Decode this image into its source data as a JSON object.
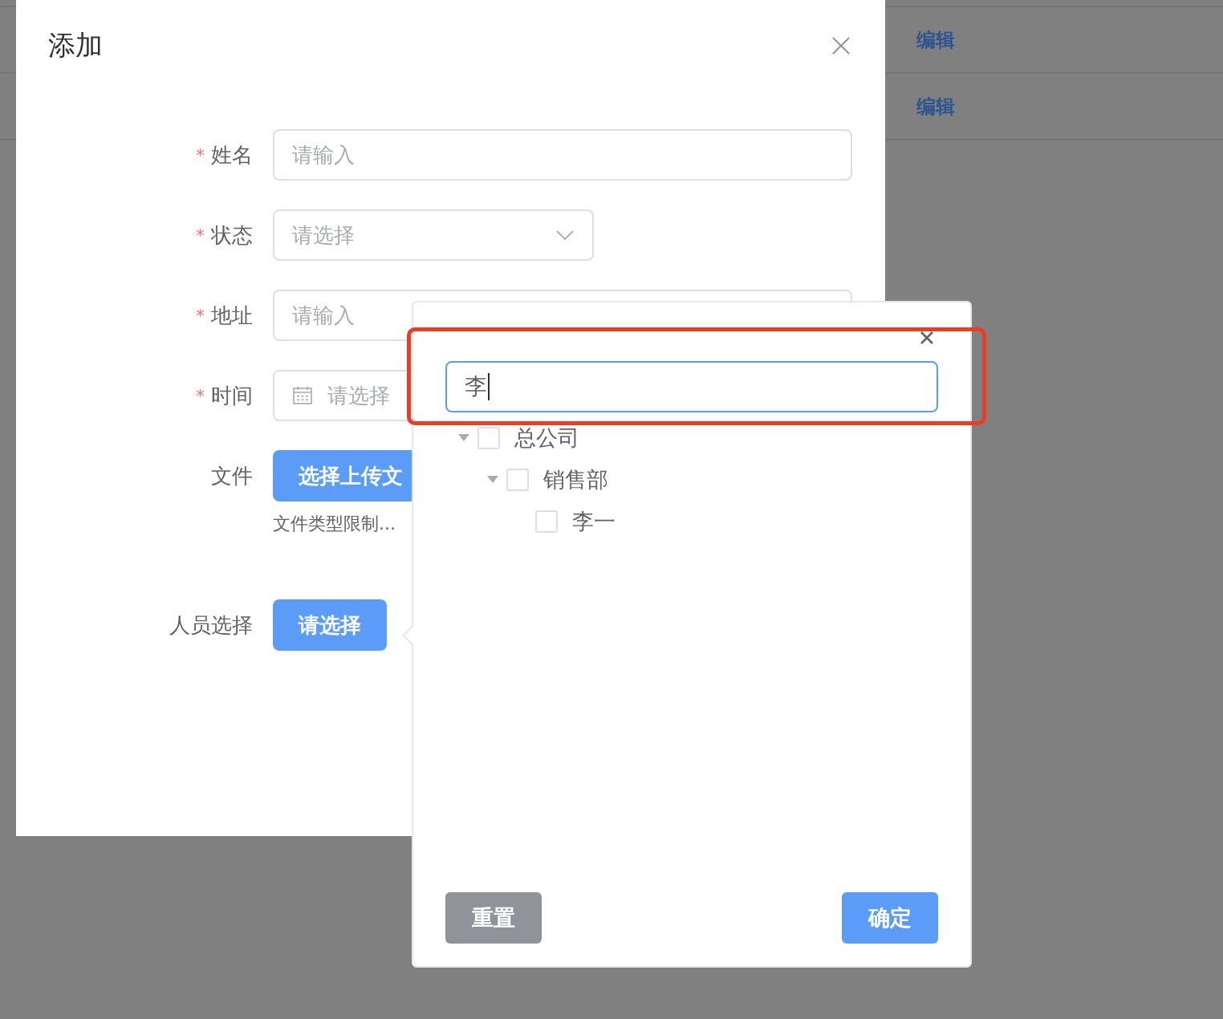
{
  "background_table": {
    "rows": [
      {
        "action": "编辑"
      },
      {
        "action": "编辑"
      }
    ]
  },
  "dialog": {
    "title": "添加",
    "fields": [
      {
        "kind": "input",
        "label": "姓名",
        "required_mark": "*",
        "placeholder": "请输入"
      },
      {
        "kind": "select",
        "label": "状态",
        "required_mark": "*",
        "placeholder": "请选择"
      },
      {
        "kind": "input",
        "label": "地址",
        "required_mark": "*",
        "placeholder": "请输入"
      },
      {
        "kind": "date",
        "label": "时间",
        "required_mark": "*",
        "placeholder": "请选择"
      },
      {
        "kind": "upload",
        "label": "文件",
        "button": "选择上传文",
        "tip": "文件类型限制..."
      },
      {
        "kind": "picker",
        "label": "人员选择",
        "button": "请选择"
      }
    ]
  },
  "popover": {
    "search": {
      "value": "李",
      "focused": true
    },
    "tree": [
      {
        "label": "总公司",
        "checked": false,
        "expanded": true,
        "children": [
          {
            "label": "销售部",
            "checked": false,
            "expanded": true,
            "children": [
              {
                "label": "李一",
                "checked": false
              }
            ]
          }
        ]
      }
    ],
    "buttons": [
      {
        "label": "重置",
        "kind": "reset"
      },
      {
        "label": "确定",
        "kind": "primary"
      }
    ]
  }
}
